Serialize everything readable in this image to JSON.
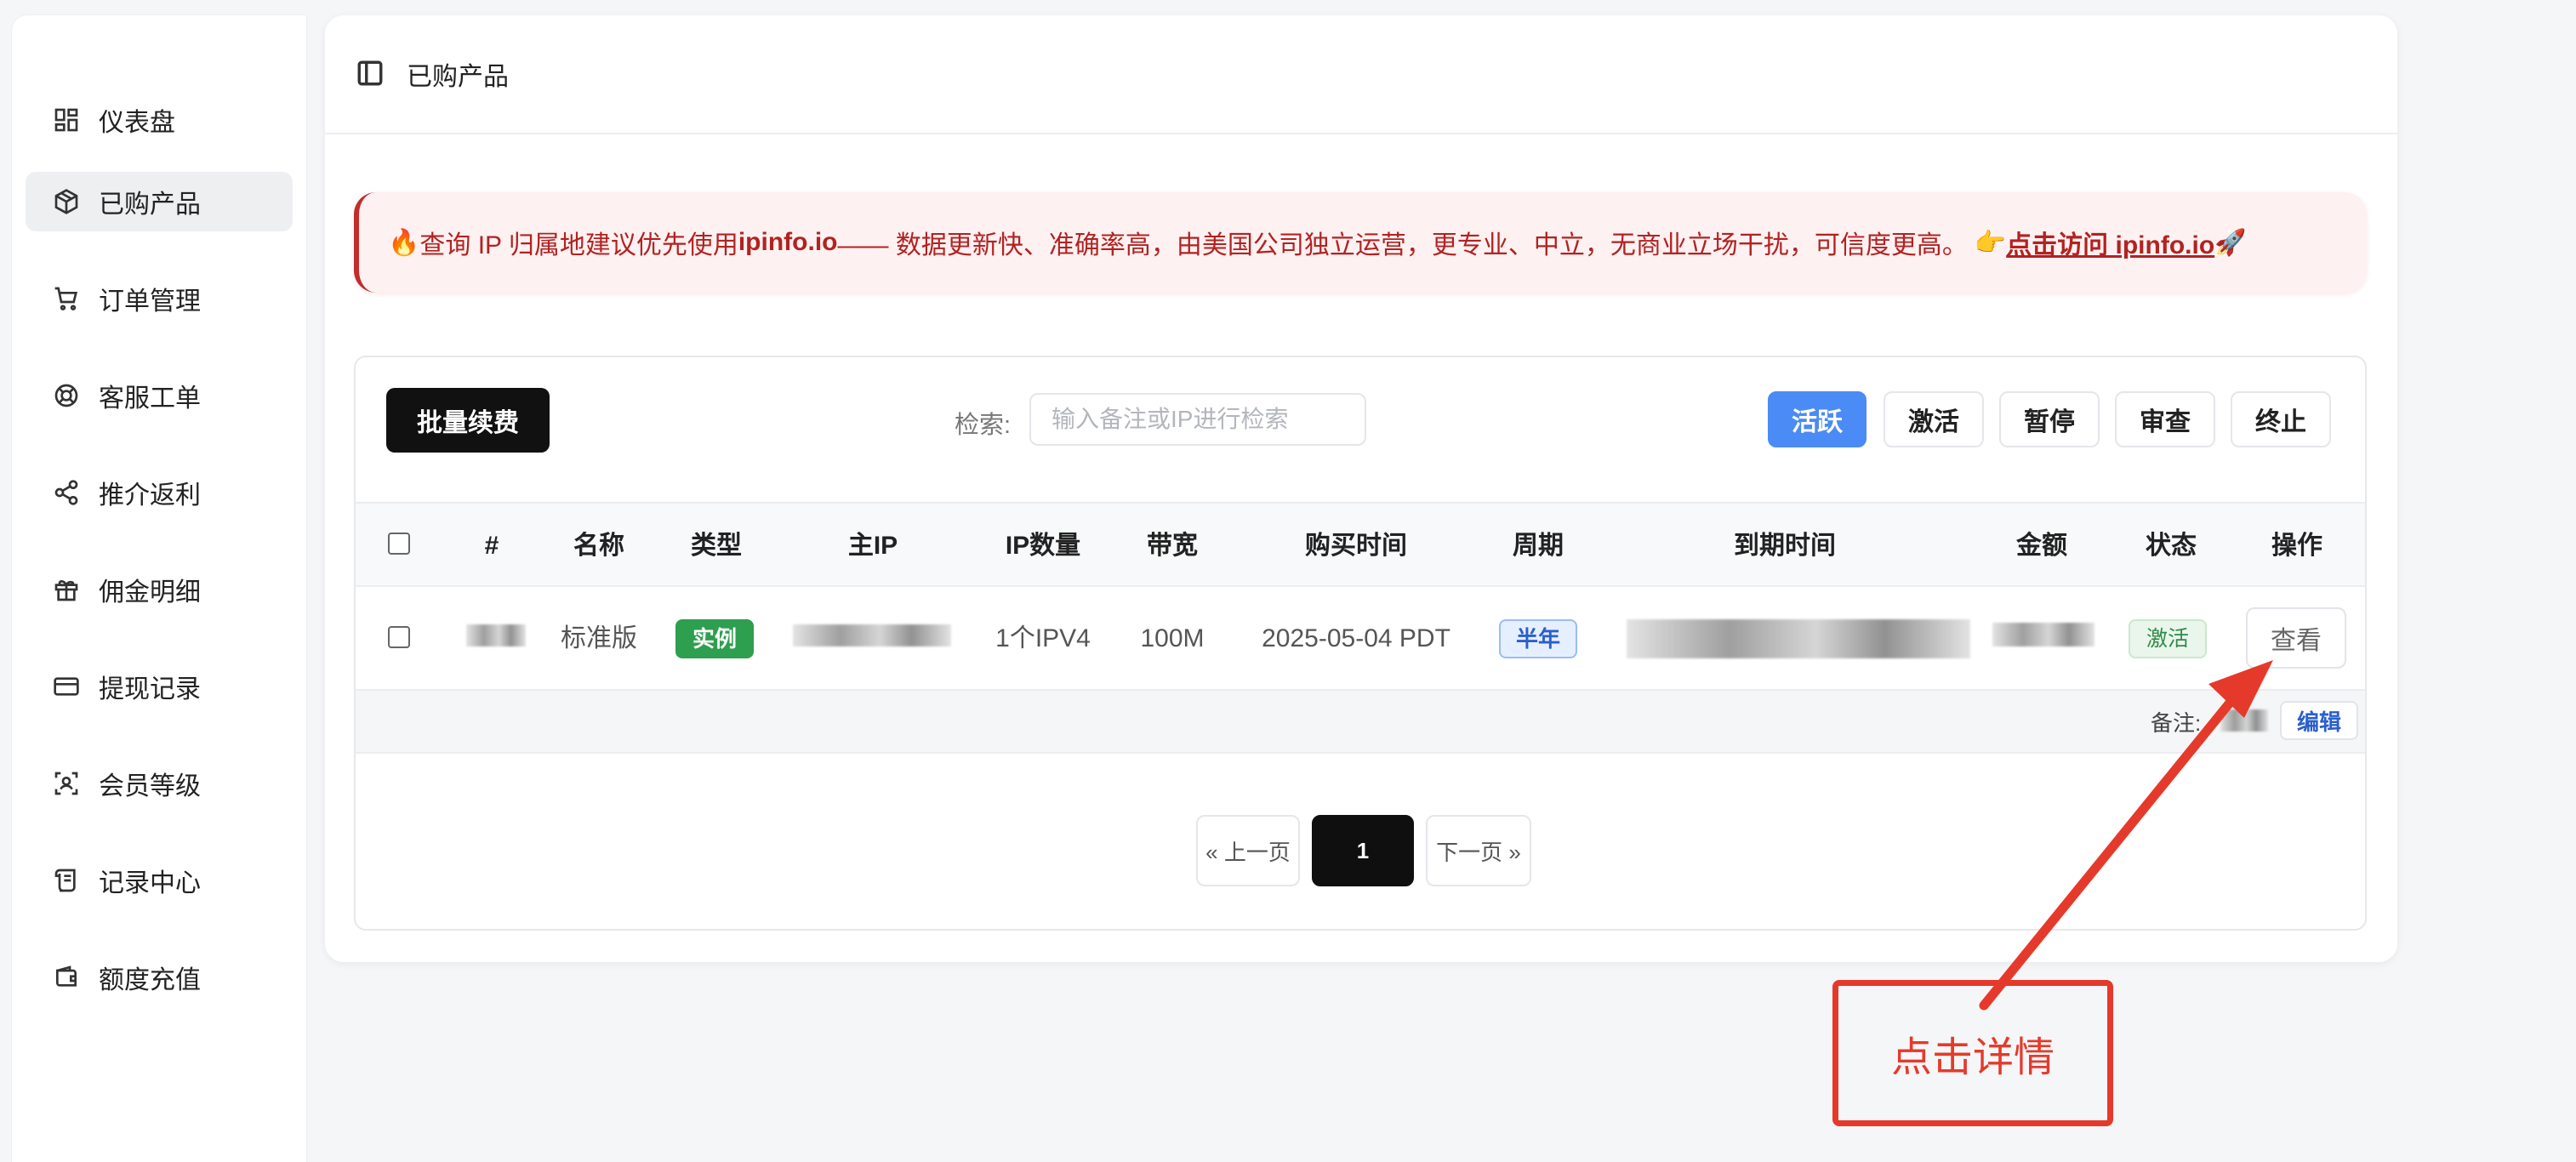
{
  "sidebar": {
    "items": [
      {
        "label": "仪表盘",
        "icon": "dashboard-icon"
      },
      {
        "label": "已购产品",
        "icon": "box-icon",
        "active": true
      },
      {
        "label": "订单管理",
        "icon": "cart-icon"
      },
      {
        "label": "客服工单",
        "icon": "lifebuoy-icon"
      },
      {
        "label": "推介返利",
        "icon": "share-icon"
      },
      {
        "label": "佣金明细",
        "icon": "gift-icon"
      },
      {
        "label": "提现记录",
        "icon": "card-icon"
      },
      {
        "label": "会员等级",
        "icon": "scan-face-icon"
      },
      {
        "label": "记录中心",
        "icon": "scroll-icon"
      },
      {
        "label": "额度充值",
        "icon": "wallet-icon"
      }
    ]
  },
  "header": {
    "title": "已购产品",
    "toggle_icon": "sidebar-toggle-icon"
  },
  "notice": {
    "prefix_emoji": "🔥",
    "text_1": " 查询 IP 归属地建议优先使用 ",
    "brand": "ipinfo.io",
    "text_2": " —— 数据更新快、准确率高，由美国公司独立运营，更专业、中立，无商业立场干扰，可信度更高。",
    "pointer_emoji": "👉",
    "link_text": "点击访问 ipinfo.io",
    "suffix_emoji": "🚀"
  },
  "toolbar": {
    "batch_renew": "批量续费",
    "search_label": "检索:",
    "search_placeholder": "输入备注或IP进行检索",
    "search_value": "",
    "filters": [
      "活跃",
      "激活",
      "暂停",
      "审查",
      "终止"
    ],
    "active_filter": "活跃"
  },
  "table": {
    "headers": [
      "#",
      "名称",
      "类型",
      "主IP",
      "IP数量",
      "带宽",
      "购买时间",
      "周期",
      "到期时间",
      "金额",
      "状态",
      "操作"
    ],
    "rows": [
      {
        "name": "标准版",
        "type": "实例",
        "ip_count": "1个IPV4",
        "bandwidth": "100M",
        "purchase_time": "2025-05-04 PDT",
        "cycle": "半年",
        "status": "激活",
        "action": "查看",
        "note_label": "备注:",
        "edit": "编辑"
      }
    ]
  },
  "pagination": {
    "prev": "« 上一页",
    "current": "1",
    "next": "下一页 »"
  },
  "annotation": {
    "label": "点击详情",
    "color": "#e53a2b"
  }
}
